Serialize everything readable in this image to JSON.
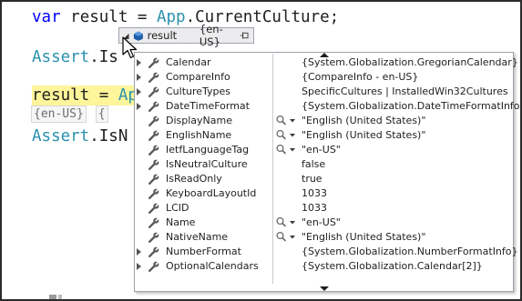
{
  "editor": {
    "line1": {
      "kw": "var",
      "ident": "result",
      "op": " = ",
      "type": "App",
      "rest": ".CurrentCulture;"
    },
    "line2": {
      "type": "Assert",
      "rest": ".Is"
    },
    "line3": {
      "ident": "result",
      "op": " = ",
      "type": "Ap"
    },
    "hints": [
      "{en-US}",
      "{"
    ],
    "line4": {
      "type": "Assert",
      "rest": ".IsN"
    }
  },
  "datatip": {
    "name": "result",
    "value": "{en-US}"
  },
  "members": [
    {
      "name": "Calendar",
      "value": "{System.Globalization.GregorianCalendar}",
      "expandable": true,
      "visualizer": false
    },
    {
      "name": "CompareInfo",
      "value": "{CompareInfo - en-US}",
      "expandable": true,
      "visualizer": false
    },
    {
      "name": "CultureTypes",
      "value": "SpecificCultures | InstalledWin32Cultures",
      "expandable": true,
      "visualizer": false
    },
    {
      "name": "DateTimeFormat",
      "value": "{System.Globalization.DateTimeFormatInfo}",
      "expandable": true,
      "visualizer": false
    },
    {
      "name": "DisplayName",
      "value": "\"English (United States)\"",
      "expandable": false,
      "visualizer": true
    },
    {
      "name": "EnglishName",
      "value": "\"English (United States)\"",
      "expandable": false,
      "visualizer": true
    },
    {
      "name": "IetfLanguageTag",
      "value": "\"en-US\"",
      "expandable": false,
      "visualizer": true
    },
    {
      "name": "IsNeutralCulture",
      "value": "false",
      "expandable": false,
      "visualizer": false
    },
    {
      "name": "IsReadOnly",
      "value": "true",
      "expandable": false,
      "visualizer": false
    },
    {
      "name": "KeyboardLayoutId",
      "value": "1033",
      "expandable": false,
      "visualizer": false
    },
    {
      "name": "LCID",
      "value": "1033",
      "expandable": false,
      "visualizer": false
    },
    {
      "name": "Name",
      "value": "\"en-US\"",
      "expandable": false,
      "visualizer": true
    },
    {
      "name": "NativeName",
      "value": "\"English (United States)\"",
      "expandable": false,
      "visualizer": true
    },
    {
      "name": "NumberFormat",
      "value": "{System.Globalization.NumberFormatInfo}",
      "expandable": true,
      "visualizer": false
    },
    {
      "name": "OptionalCalendars",
      "value": "{System.Globalization.Calendar[2]}",
      "expandable": true,
      "visualizer": false
    }
  ],
  "colors": {
    "keyword": "#0000ff",
    "type": "#2b91af",
    "current_line_highlight": "#fff59a",
    "wrench_icon": "#5a5a5a",
    "object_icon": "#1f5fa8"
  },
  "icons": {
    "datatip_object": "object-icon",
    "datatip_pin": "pin-icon",
    "member": "wrench-icon",
    "visualizer": "magnifier-icon",
    "expander": "expand-arrow-icon"
  }
}
